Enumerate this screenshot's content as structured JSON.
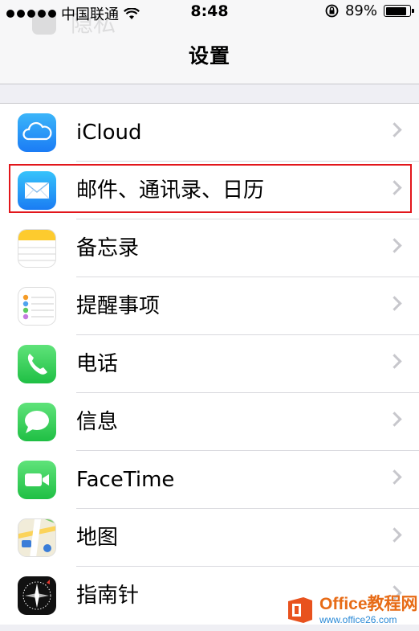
{
  "status_bar": {
    "carrier": "中国联通",
    "time": "8:48",
    "battery_percent": "89%",
    "battery_level": 0.89,
    "signal_dots": 5,
    "wifi_icon": "wifi-icon",
    "rotation_lock_icon": "rotation-lock-icon"
  },
  "ghost_row": {
    "label": "隐私"
  },
  "nav": {
    "title": "设置"
  },
  "settings": {
    "items": [
      {
        "label": "iCloud",
        "icon": "icloud-icon"
      },
      {
        "label": "邮件、通讯录、日历",
        "icon": "mail-icon"
      },
      {
        "label": "备忘录",
        "icon": "notes-icon"
      },
      {
        "label": "提醒事项",
        "icon": "reminders-icon"
      },
      {
        "label": "电话",
        "icon": "phone-icon"
      },
      {
        "label": "信息",
        "icon": "messages-icon"
      },
      {
        "label": "FaceTime",
        "icon": "facetime-icon"
      },
      {
        "label": "地图",
        "icon": "maps-icon"
      },
      {
        "label": "指南针",
        "icon": "compass-icon"
      }
    ]
  },
  "watermark": {
    "brand": "Office教程网",
    "url": "www.office26.com"
  },
  "colors": {
    "highlight": "#e2161b",
    "chevron": "#c7c7cc",
    "background": "#efeff4"
  }
}
